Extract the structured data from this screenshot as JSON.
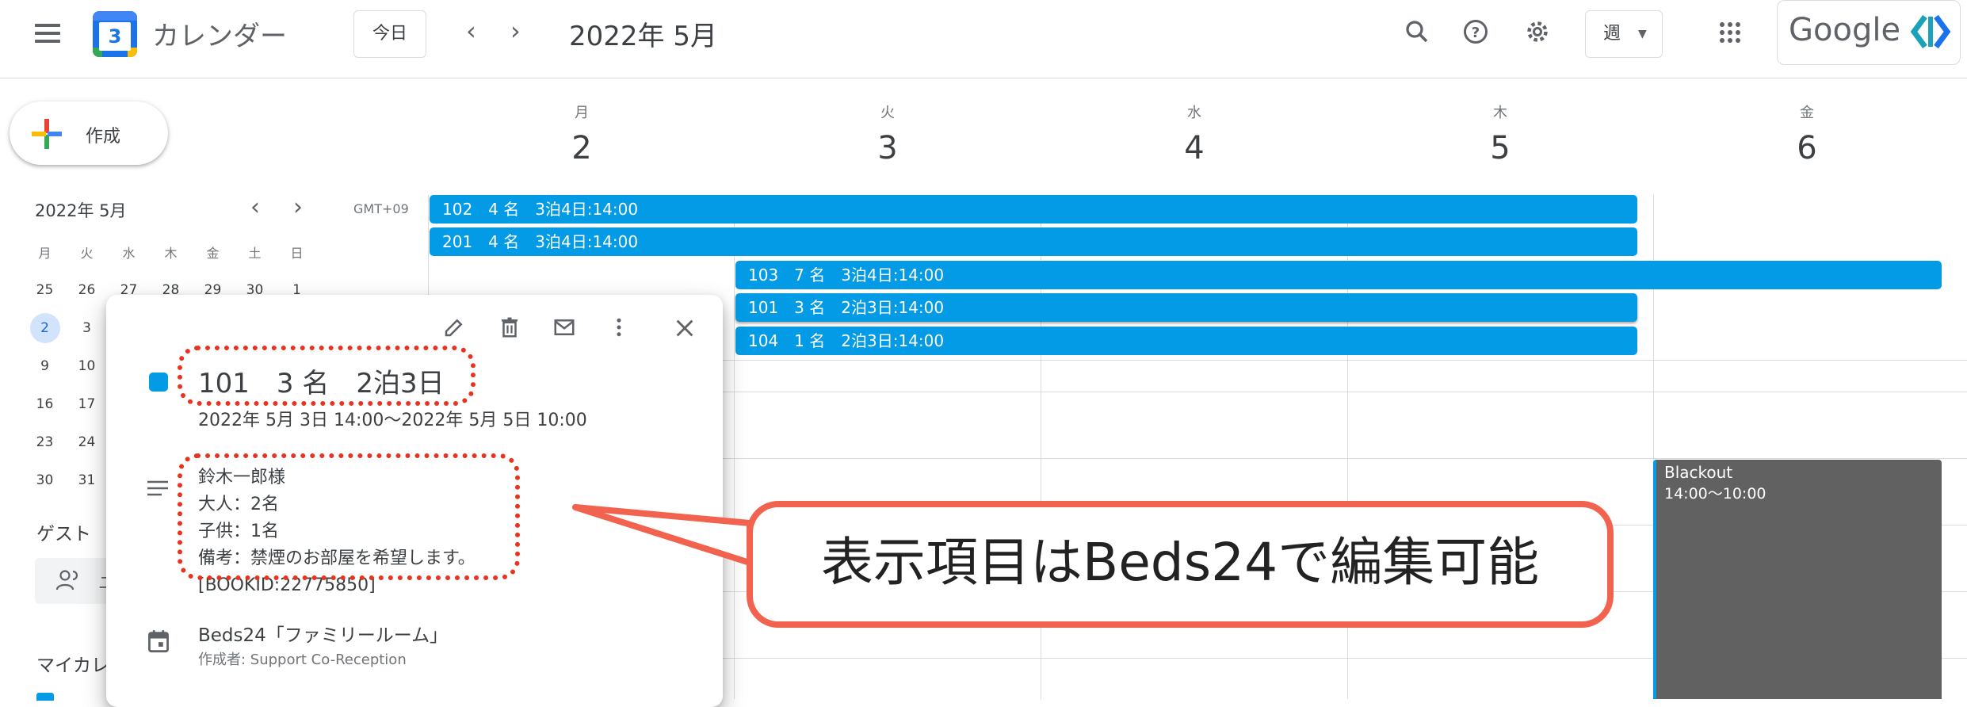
{
  "header": {
    "app_name": "カレンダー",
    "logo_number": "3",
    "today_label": "今日",
    "current_period": "2022年 5月",
    "view_select": "週",
    "brand_text": "Google"
  },
  "sidebar": {
    "create_label": "作成",
    "mini_month": "2022年 5月",
    "weekdays": [
      "月",
      "火",
      "水",
      "木",
      "金",
      "土",
      "日"
    ],
    "rows": [
      [
        "25",
        "26",
        "27",
        "28",
        "29",
        "30",
        "1"
      ],
      [
        "2",
        "3"
      ],
      [
        "9",
        "10"
      ],
      [
        "16",
        "17"
      ],
      [
        "23",
        "24"
      ],
      [
        "30",
        "31"
      ]
    ],
    "guests_heading": "ゲスト",
    "guest_search_partial": "ユ",
    "my_calendars_partial": "マイカレ"
  },
  "grid": {
    "timezone": "GMT+09",
    "days": [
      {
        "name": "月",
        "num": "2"
      },
      {
        "name": "火",
        "num": "3"
      },
      {
        "name": "水",
        "num": "4"
      },
      {
        "name": "木",
        "num": "5"
      },
      {
        "name": "金",
        "num": "6"
      }
    ],
    "events": [
      "102　4 名　3泊4日:14:00",
      "201　4 名　3泊4日:14:00",
      "103　7 名　3泊4日:14:00",
      "101　3 名　2泊3日:14:00",
      "104　1 名　2泊3日:14:00"
    ],
    "blackout": {
      "title": "Blackout",
      "time": "14:00〜10:00"
    }
  },
  "popup": {
    "title": "101　3 名　2泊3日",
    "datetime": "2022年 5月 3日 14:00〜2022年 5月 5日 10:00",
    "description": [
      "鈴木一郎様",
      "大人：2名",
      "子供：1名",
      "備考：禁煙のお部屋を希望します。",
      "[BOOKID:22775850]"
    ],
    "calendar_name": "Beds24「ファミリールーム」",
    "creator": "作成者: Support Co-Reception"
  },
  "annotation": {
    "callout_text": "表示項目はBeds24で編集可能"
  },
  "colors": {
    "event_blue": "#039be5",
    "blackout_gray": "#616161",
    "annotation_red": "#e8331f",
    "callout_border": "#f2634f"
  }
}
